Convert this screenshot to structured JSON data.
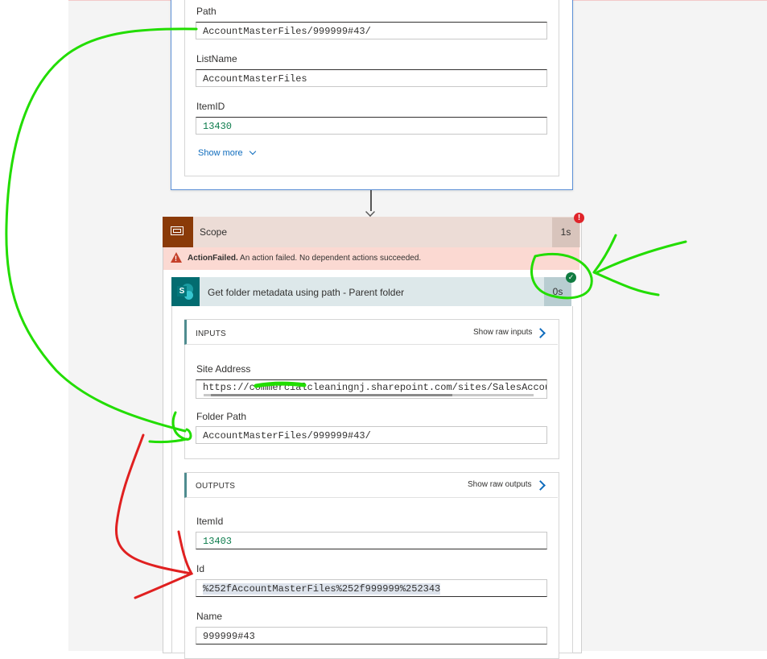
{
  "previous_action": {
    "fields": [
      {
        "label": "Path",
        "value": "AccountMasterFiles/999999#43/"
      },
      {
        "label": "ListName",
        "value": "AccountMasterFiles"
      },
      {
        "label": "ItemID",
        "value": "13430"
      }
    ],
    "show_more": "Show more"
  },
  "scope": {
    "title": "Scope",
    "duration": "1s",
    "error_badge": "!",
    "fail_code": "ActionFailed.",
    "fail_message": "An action failed. No dependent actions succeeded."
  },
  "action": {
    "title": "Get folder metadata using path - Parent folder",
    "duration": "0s",
    "inputs": {
      "title": "INPUTS",
      "raw_link": "Show raw inputs",
      "site_address_label": "Site Address",
      "site_address_value": "https://commercialcleaningnj.sharepoint.com/sites/SalesAccoun",
      "folder_path_label": "Folder Path",
      "folder_path_value": "AccountMasterFiles/999999#43/"
    },
    "outputs": {
      "title": "OUTPUTS",
      "raw_link": "Show raw outputs",
      "fields": [
        {
          "label": "ItemId",
          "value": "13403"
        },
        {
          "label": "Id",
          "value": "%252fAccountMasterFiles%252f999999%252343"
        },
        {
          "label": "Name",
          "value": "999999#43"
        }
      ]
    }
  },
  "colors": {
    "annotation_green": "#22dd00",
    "annotation_red": "#e02020",
    "scope_icon": "#8a3a08",
    "sharepoint_icon": "#036c70",
    "link_blue": "#0f6cbd"
  },
  "icons": [
    "scope-icon",
    "warning-icon",
    "error-icon",
    "sharepoint-icon",
    "success-check-icon",
    "chevron-down-icon",
    "chevron-right-icon",
    "arrow-down-icon"
  ]
}
